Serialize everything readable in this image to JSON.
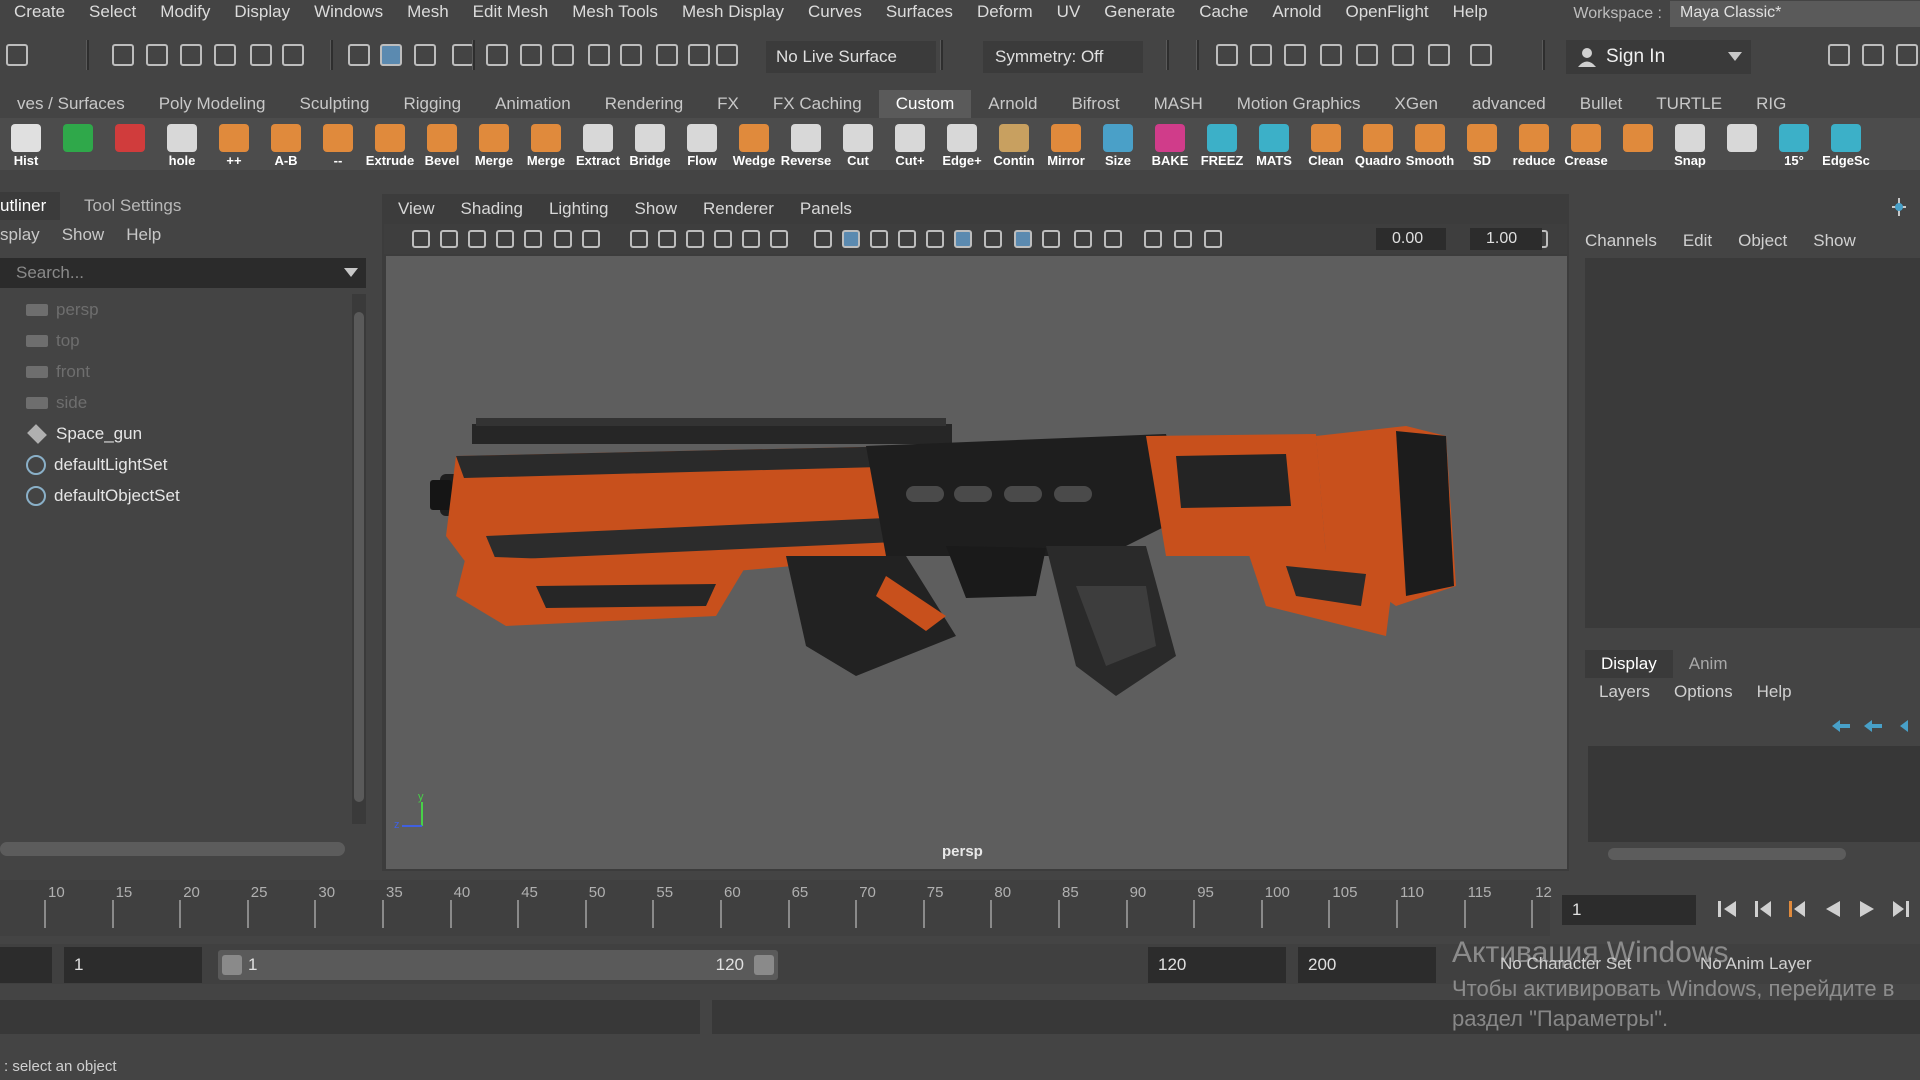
{
  "menu": [
    "Create",
    "Select",
    "Modify",
    "Display",
    "Windows",
    "Mesh",
    "Edit Mesh",
    "Mesh Tools",
    "Mesh Display",
    "Curves",
    "Surfaces",
    "Deform",
    "UV",
    "Generate",
    "Cache",
    "Arnold",
    "OpenFlight",
    "Help"
  ],
  "workspace": {
    "label": "Workspace :",
    "value": "Maya Classic*"
  },
  "statusline": {
    "live_surface": "No Live Surface",
    "symmetry": "Symmetry: Off",
    "sign_in": "Sign In"
  },
  "shelf_tabs": [
    "ves / Surfaces",
    "Poly Modeling",
    "Sculpting",
    "Rigging",
    "Animation",
    "Rendering",
    "FX",
    "FX Caching",
    "Custom",
    "Arnold",
    "Bifrost",
    "MASH",
    "Motion Graphics",
    "XGen",
    "advanced",
    "Bullet",
    "TURTLE",
    "RIG"
  ],
  "shelf_active_tab": "Custom",
  "shelf_buttons": [
    {
      "label": "Hist",
      "color": "#e0e0e0"
    },
    {
      "label": "",
      "color": "#2fa84a"
    },
    {
      "label": "",
      "color": "#d03c3c"
    },
    {
      "label": "hole",
      "color": "#d8d8d8"
    },
    {
      "label": "++",
      "color": "#e08a3c"
    },
    {
      "label": "A-B",
      "color": "#e08a3c"
    },
    {
      "label": "--",
      "color": "#e08a3c"
    },
    {
      "label": "Extrude",
      "color": "#e08a3c"
    },
    {
      "label": "Bevel",
      "color": "#e08a3c"
    },
    {
      "label": "Merge",
      "color": "#e08a3c"
    },
    {
      "label": "Merge",
      "color": "#e08a3c"
    },
    {
      "label": "Extract",
      "color": "#d8d8d8"
    },
    {
      "label": "Bridge",
      "color": "#d8d8d8"
    },
    {
      "label": "Flow",
      "color": "#d8d8d8"
    },
    {
      "label": "Wedge",
      "color": "#e08a3c"
    },
    {
      "label": "Reverse",
      "color": "#d8d8d8"
    },
    {
      "label": "Cut",
      "color": "#d8d8d8"
    },
    {
      "label": "Cut+",
      "color": "#d8d8d8"
    },
    {
      "label": "Edge+",
      "color": "#d8d8d8"
    },
    {
      "label": "Contin",
      "color": "#c8a060"
    },
    {
      "label": "Mirror",
      "color": "#e08a3c"
    },
    {
      "label": "Size",
      "color": "#4aa0c8"
    },
    {
      "label": "BAKE",
      "color": "#d03c8a"
    },
    {
      "label": "FREEZ",
      "color": "#3cb0c8"
    },
    {
      "label": "MATS",
      "color": "#3cb0c8"
    },
    {
      "label": "Clean",
      "color": "#e08a3c"
    },
    {
      "label": "Quadro",
      "color": "#e08a3c"
    },
    {
      "label": "Smooth",
      "color": "#e08a3c"
    },
    {
      "label": "SD",
      "color": "#e08a3c"
    },
    {
      "label": "reduce",
      "color": "#e08a3c"
    },
    {
      "label": "Crease",
      "color": "#e08a3c"
    },
    {
      "label": "",
      "color": "#e08a3c"
    },
    {
      "label": "Snap",
      "color": "#d8d8d8"
    },
    {
      "label": "",
      "color": "#d8d8d8"
    },
    {
      "label": "15°",
      "color": "#3cb0c8"
    },
    {
      "label": "EdgeSc",
      "color": "#3cb0c8"
    }
  ],
  "outliner": {
    "tabs": [
      "utliner",
      "Tool Settings"
    ],
    "menu": [
      "splay",
      "Show",
      "Help"
    ],
    "search_placeholder": "Search...",
    "items": [
      {
        "label": "persp",
        "kind": "camera"
      },
      {
        "label": "top",
        "kind": "camera"
      },
      {
        "label": "front",
        "kind": "camera"
      },
      {
        "label": "side",
        "kind": "camera"
      },
      {
        "label": "Space_gun",
        "kind": "mesh"
      },
      {
        "label": "defaultLightSet",
        "kind": "set"
      },
      {
        "label": "defaultObjectSet",
        "kind": "set"
      }
    ]
  },
  "viewport": {
    "menu": [
      "View",
      "Shading",
      "Lighting",
      "Show",
      "Renderer",
      "Panels"
    ],
    "value_a": "0.00",
    "value_b": "1.00",
    "camera_label": "persp",
    "axis_y": "y",
    "axis_z": "z"
  },
  "channelbox": {
    "menu": [
      "Channels",
      "Edit",
      "Object",
      "Show"
    ]
  },
  "layers": {
    "tabs": [
      "Display",
      "Anim"
    ],
    "menu": [
      "Layers",
      "Options",
      "Help"
    ]
  },
  "timeline": {
    "ticks": [
      "10",
      "15",
      "20",
      "25",
      "30",
      "35",
      "40",
      "45",
      "50",
      "55",
      "60",
      "65",
      "70",
      "75",
      "80",
      "85",
      "90",
      "95",
      "100",
      "105",
      "110",
      "115",
      "12"
    ],
    "current_frame": "1"
  },
  "range": {
    "start": "1",
    "range_start": "1",
    "range_end": "120",
    "end": "120",
    "max": "200",
    "character_set": "No Character Set",
    "anim_layer": "No Anim Layer"
  },
  "help_line": ": select an object",
  "watermark": {
    "title": "Активация Windows",
    "line1": "Чтобы активировать Windows, перейдите в",
    "line2": "раздел \"Параметры\"."
  }
}
